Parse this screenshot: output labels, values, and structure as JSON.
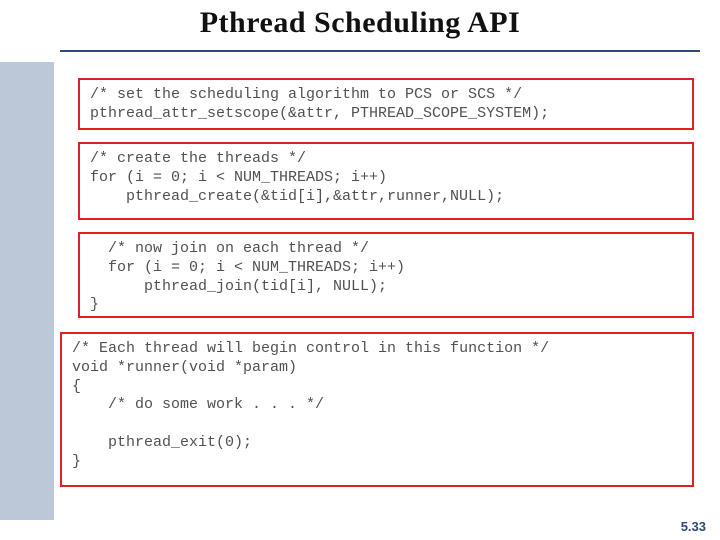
{
  "title": "Pthread Scheduling API",
  "page_number": "5.33",
  "code_blocks": {
    "block1": "/* set the scheduling algorithm to PCS or SCS */\npthread_attr_setscope(&attr, PTHREAD_SCOPE_SYSTEM);",
    "block2": "/* create the threads */\nfor (i = 0; i < NUM_THREADS; i++)\n    pthread_create(&tid[i],&attr,runner,NULL);",
    "block3": "  /* now join on each thread */\n  for (i = 0; i < NUM_THREADS; i++)\n      pthread_join(tid[i], NULL);\n}",
    "block4": "/* Each thread will begin control in this function */\nvoid *runner(void *param)\n{\n    /* do some work . . . */\n\n    pthread_exit(0);\n}"
  }
}
